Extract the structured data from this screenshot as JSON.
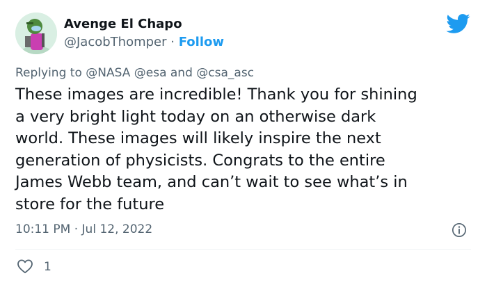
{
  "author": {
    "name": "Avenge El Chapo",
    "handle": "@JacobThomper",
    "separator": "·",
    "follow_label": "Follow"
  },
  "reply": {
    "prefix": "Replying to",
    "mention_1": "@NASA",
    "mention_2": "@esa",
    "conjunction": "and",
    "mention_3": "@csa_asc"
  },
  "tweet": {
    "lines": [
      "These images are incredible! Thank you for shining",
      "a very bright light today on an otherwise dark",
      "world. These images will likely inspire the next",
      "generation of physicists. Congrats to the entire",
      "James Webb team, and can’t wait to see what’s in",
      "store for the future"
    ],
    "timestamp": "10:11 PM · Jul 12, 2022",
    "like_count": "1"
  },
  "icons": {
    "logo": "twitter-bird-icon",
    "info": "info-icon",
    "like": "heart-icon"
  },
  "colors": {
    "brand": "#1d9bf0",
    "text": "#0f1419",
    "muted": "#536471",
    "avatar_bg": "#d9efe3"
  }
}
